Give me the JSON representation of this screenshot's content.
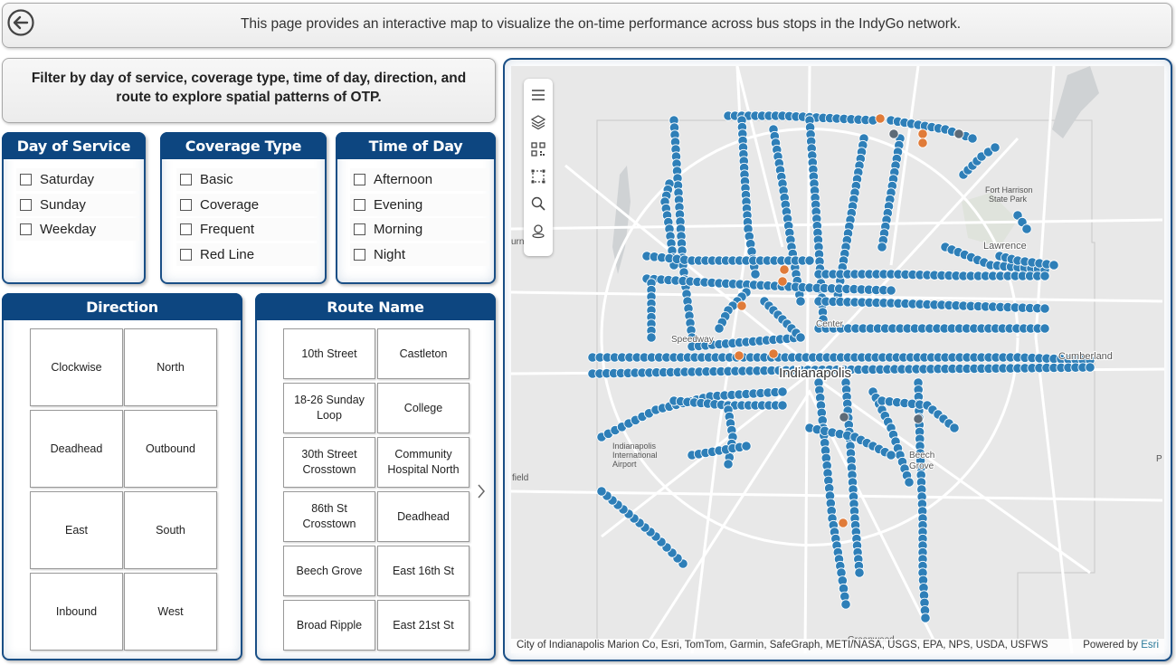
{
  "header": {
    "description": "This page provides an interactive map to visualize the on-time performance across bus stops in the IndyGo network."
  },
  "instructions": {
    "text": "Filter by day of service, coverage type, time of day, direction, and route to explore spatial patterns of OTP."
  },
  "filters": {
    "day_of_service": {
      "title": "Day of Service",
      "options": [
        "Saturday",
        "Sunday",
        "Weekday"
      ]
    },
    "coverage_type": {
      "title": "Coverage Type",
      "options": [
        "Basic",
        "Coverage",
        "Frequent",
        "Red Line"
      ]
    },
    "time_of_day": {
      "title": "Time of Day",
      "options": [
        "Afternoon",
        "Evening",
        "Morning",
        "Night"
      ]
    }
  },
  "direction": {
    "title": "Direction",
    "tiles": [
      "Clockwise",
      "North",
      "Deadhead",
      "Outbound",
      "East",
      "South",
      "Inbound",
      "West"
    ]
  },
  "route_name": {
    "title": "Route Name",
    "tiles": [
      "10th Street",
      "Castleton",
      "18-26 Sunday Loop",
      "College",
      "30th Street Crosstown",
      "Community Hospital North",
      "86th St Crosstown",
      "Deadhead",
      "Beech Grove",
      "East 16th St",
      "Broad Ripple",
      "East 21st St"
    ]
  },
  "map": {
    "labels": {
      "indianapolis": "Indianapolis",
      "lawrence": "Lawrence",
      "cumberland": "Cumberland",
      "speedway": "Speedway",
      "center": "Center",
      "beech_grove": "Beech\nGrove",
      "airport": "Indianapolis\nInternational\nAirport",
      "fort_harrison": "Fort Harrison\nState Park",
      "greenwood": "Greenwood",
      "field": "field",
      "urn": "urn",
      "p": "P"
    },
    "attribution": "City of Indianapolis Marion Co, Esri, TomTom, Garmin, SafeGraph, METI/NASA, USGS, EPA, NPS, USDA, USFWS",
    "powered_by": "Powered by",
    "esri": "Esri",
    "colors": {
      "on_time": "#2e7fb8",
      "late": "#e07b39",
      "other": "#5d6b78"
    }
  }
}
